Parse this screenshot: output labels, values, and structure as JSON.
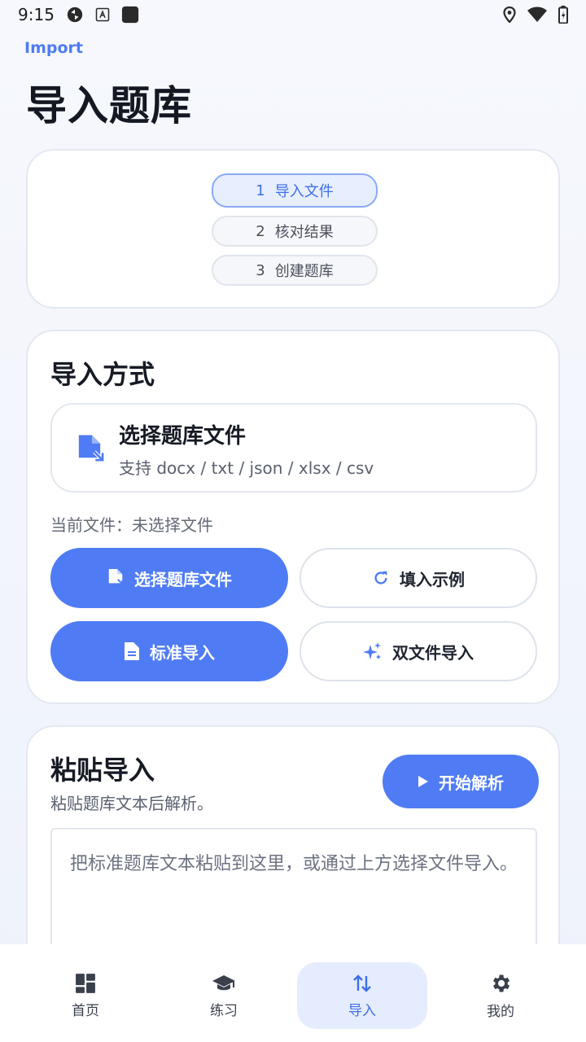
{
  "status_bar": {
    "time": "9:15",
    "icons": [
      "sync-icon",
      "font-icon",
      "app-icon",
      "location-icon",
      "wifi-icon",
      "battery-icon"
    ]
  },
  "breadcrumb": "Import",
  "title": "导入题库",
  "steps": [
    {
      "num": "1",
      "label": "导入文件",
      "active": true
    },
    {
      "num": "2",
      "label": "核对结果",
      "active": false
    },
    {
      "num": "3",
      "label": "创建题库",
      "active": false
    }
  ],
  "import_section": {
    "title": "导入方式",
    "file_box": {
      "title": "选择题库文件",
      "formats": "支持 docx / txt / json / xlsx / csv"
    },
    "current_file": "当前文件：未选择文件",
    "buttons": {
      "choose_file": "选择题库文件",
      "fill_example": "填入示例",
      "standard_import": "标准导入",
      "dual_file_import": "双文件导入"
    }
  },
  "paste_section": {
    "title": "粘贴导入",
    "subtitle": "粘贴题库文本后解析。",
    "parse_button": "开始解析",
    "placeholder": "把标准题库文本粘贴到这里，或通过上方选择文件导入。"
  },
  "bottom_nav": [
    {
      "label": "首页",
      "icon": "dashboard-icon",
      "active": false
    },
    {
      "label": "练习",
      "icon": "school-icon",
      "active": false
    },
    {
      "label": "导入",
      "icon": "swap-vertical-icon",
      "active": true
    },
    {
      "label": "我的",
      "icon": "gear-icon",
      "active": false
    }
  ],
  "colors": {
    "accent": "#4f7cf4",
    "accent_light": "#e5ecfd",
    "text_primary": "#161a24",
    "text_secondary": "#5a6070"
  }
}
